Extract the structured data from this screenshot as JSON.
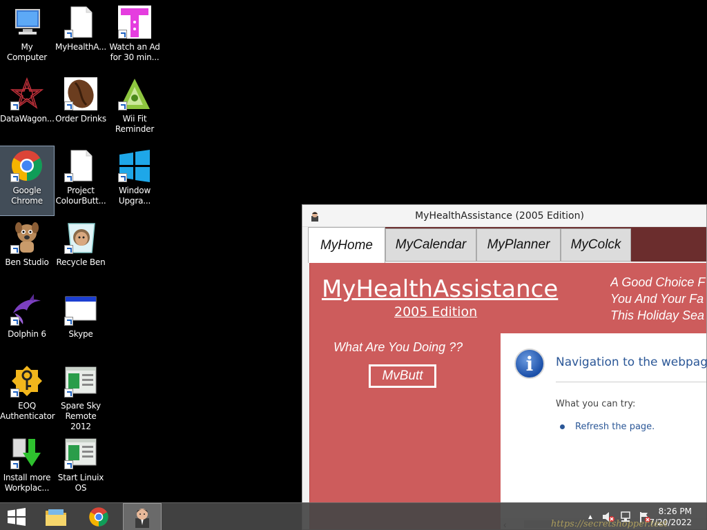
{
  "desktop": {
    "icons": [
      {
        "label": "My Computer",
        "icon": "my-computer-icon"
      },
      {
        "label": "MyHealthA...",
        "icon": "document-icon"
      },
      {
        "label": "Watch an Ad for 30 min...",
        "icon": "pink-t-icon"
      },
      {
        "label": "DataWagon...",
        "icon": "red-star-icon"
      },
      {
        "label": "Order Drinks",
        "icon": "coffee-bean-icon"
      },
      {
        "label": "Wii Fit Reminder",
        "icon": "green-triangle-icon"
      },
      {
        "label": "Google Chrome",
        "icon": "chrome-icon",
        "selected": true
      },
      {
        "label": "Project ColourButt...",
        "icon": "document-icon"
      },
      {
        "label": "Window Upgra...",
        "icon": "windows-logo-icon"
      },
      {
        "label": "Ben Studio",
        "icon": "dog-icon"
      },
      {
        "label": "Recycle Ben",
        "icon": "recycle-bin-face-icon"
      },
      {
        "label": "Dolphin 6",
        "icon": "dolphin-icon"
      },
      {
        "label": "Skype",
        "icon": "window-icon"
      },
      {
        "label": "EOQ Authenticator",
        "icon": "key-badge-icon"
      },
      {
        "label": "Spare Sky Remote 2012",
        "icon": "remote-desktop-icon"
      },
      {
        "label": "Install more Workplac...",
        "icon": "download-arrow-icon"
      },
      {
        "label": "Start Linuix OS",
        "icon": "remote-desktop-icon"
      }
    ]
  },
  "window": {
    "title": "MyHealthAssistance (2005 Edition)",
    "tabs": [
      {
        "label": "MyHome",
        "active": true
      },
      {
        "label": "MyCalendar"
      },
      {
        "label": "MyPlanner"
      },
      {
        "label": "MyColck"
      }
    ],
    "brand_title": "MyHealthAssistance",
    "brand_edition": "2005 Edition",
    "tagline": "A Good Choice F\nYou And Your Fa\nThis Holiday Sea",
    "question": "What Are You Doing ??",
    "button_label": "MvButt",
    "browser": {
      "message": "Navigation to the webpage",
      "try_label": "What you can try:",
      "refresh_link": "Refresh the page."
    }
  },
  "taskbar": {
    "time": "8:26 PM",
    "date": "7/20/2022",
    "watermark": "https://secretshopper.test"
  },
  "colors": {
    "content_bg": "#cd5c5c",
    "tabstrip_bg": "#6b2d2d",
    "link": "#2b5797"
  }
}
